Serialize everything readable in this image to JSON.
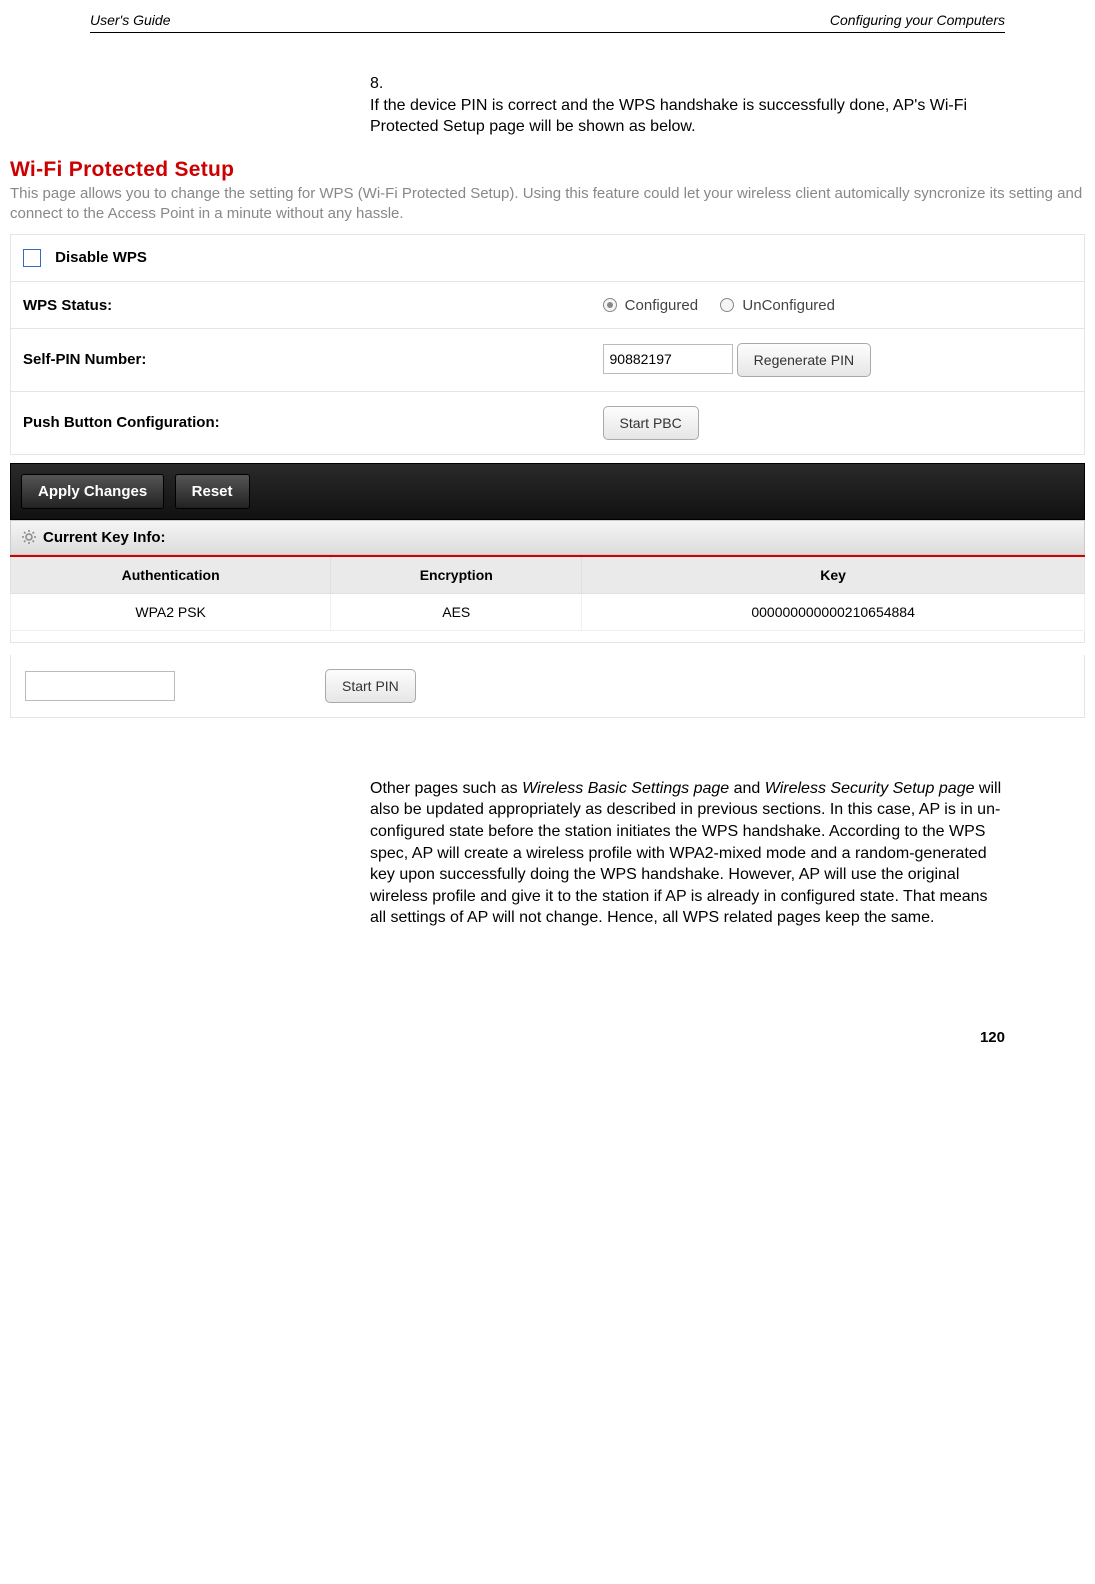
{
  "header": {
    "left": "User's Guide",
    "right": "Configuring your Computers"
  },
  "step": {
    "number": "8.",
    "text": "If the device PIN is correct and the WPS handshake is successfully done, AP's Wi-Fi Protected Setup page will be shown as below."
  },
  "wps": {
    "title": "Wi-Fi Protected Setup",
    "description": "This page allows you to change the setting for WPS (Wi-Fi Protected Setup). Using this feature could let your wireless client automically syncronize its setting and connect to the Access Point in a minute without any hassle.",
    "disable_label": "Disable WPS",
    "status_label": "WPS Status:",
    "status_options": {
      "configured": "Configured",
      "unconfigured": "UnConfigured"
    },
    "self_pin_label": "Self-PIN Number:",
    "self_pin_value": "90882197",
    "regen_button": "Regenerate PIN",
    "pbc_label": "Push Button Configuration:",
    "pbc_button": "Start PBC",
    "apply_button": "Apply Changes",
    "reset_button": "Reset",
    "key_info_header": "Current Key Info:",
    "key_table": {
      "headers": {
        "auth": "Authentication",
        "enc": "Encryption",
        "key": "Key"
      },
      "row": {
        "auth": "WPA2 PSK",
        "enc": "AES",
        "key": "000000000000210654884"
      }
    },
    "start_pin_button": "Start PIN"
  },
  "follow": {
    "part1": "Other pages such as ",
    "italic1": "Wireless Basic Settings page",
    "part2": " and ",
    "italic2": "Wireless Security Setup page",
    "part3": " will also be updated appropriately as described in previous sections. In this case, AP is in un-configured state before the station initiates the WPS handshake. According to the WPS spec, AP will create a wireless profile with WPA2-mixed mode and a random-generated key upon successfully doing the WPS handshake. However, AP will use the original wireless profile and give it to the station if AP is already in configured state. That means all settings of AP will not change. Hence, all WPS related pages keep the same."
  },
  "page_number": "120"
}
